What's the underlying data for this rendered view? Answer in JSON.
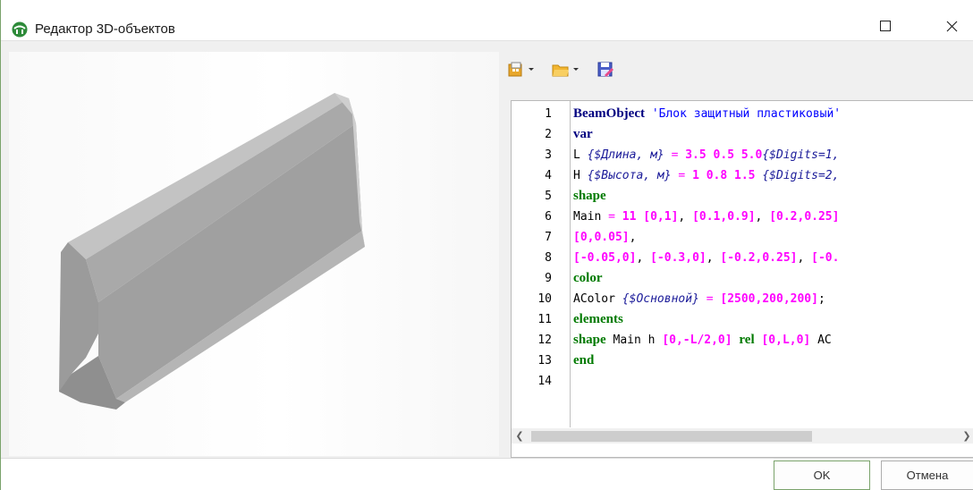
{
  "window": {
    "title": "Редактор 3D-объектов"
  },
  "toolbar": {
    "items": [
      "templates-dropdown",
      "open-dropdown",
      "save"
    ]
  },
  "editor": {
    "line_numbers": [
      "1",
      "2",
      "3",
      "4",
      "5",
      "6",
      "7",
      "8",
      "9",
      "10",
      "11",
      "12",
      "13",
      "14"
    ],
    "lines": [
      [
        {
          "c": "kwb",
          "t": "BeamObject"
        },
        {
          "c": "pl",
          "t": " "
        },
        {
          "c": "str",
          "t": "'Блок защитный пластиковый'"
        }
      ],
      [
        {
          "c": "kwb",
          "t": "var"
        }
      ],
      [
        {
          "c": "pl",
          "t": "L "
        },
        {
          "c": "cm",
          "t": "{$Длина, м}"
        },
        {
          "c": "pl",
          "t": " "
        },
        {
          "c": "op",
          "t": "="
        },
        {
          "c": "pl",
          "t": " "
        },
        {
          "c": "num",
          "t": "3.5 0.5 5.0"
        },
        {
          "c": "cm",
          "t": "{$Digits=1,"
        }
      ],
      [
        {
          "c": "pl",
          "t": "H "
        },
        {
          "c": "cm",
          "t": "{$Высота, м}"
        },
        {
          "c": "pl",
          "t": " "
        },
        {
          "c": "op",
          "t": "="
        },
        {
          "c": "pl",
          "t": " "
        },
        {
          "c": "num",
          "t": "1 0.8 1.5"
        },
        {
          "c": "pl",
          "t": " "
        },
        {
          "c": "cm",
          "t": "{$Digits=2,"
        }
      ],
      [
        {
          "c": "kw",
          "t": "shape"
        }
      ],
      [
        {
          "c": "pl",
          "t": "Main "
        },
        {
          "c": "op",
          "t": "="
        },
        {
          "c": "pl",
          "t": " "
        },
        {
          "c": "num",
          "t": "11 [0,1]"
        },
        {
          "c": "pl",
          "t": ", "
        },
        {
          "c": "num",
          "t": "[0.1,0.9]"
        },
        {
          "c": "pl",
          "t": ", "
        },
        {
          "c": "num",
          "t": "[0.2,0.25]"
        }
      ],
      [
        {
          "c": "num",
          "t": "[0,0.05]"
        },
        {
          "c": "pl",
          "t": ","
        }
      ],
      [
        {
          "c": "num",
          "t": "[-0.05,0]"
        },
        {
          "c": "pl",
          "t": ", "
        },
        {
          "c": "num",
          "t": "[-0.3,0]"
        },
        {
          "c": "pl",
          "t": ", "
        },
        {
          "c": "num",
          "t": "[-0.2,0.25]"
        },
        {
          "c": "pl",
          "t": ", "
        },
        {
          "c": "num",
          "t": "[-0."
        }
      ],
      [
        {
          "c": "kw",
          "t": "color"
        }
      ],
      [
        {
          "c": "pl",
          "t": "AColor "
        },
        {
          "c": "cm",
          "t": "{$Основной}"
        },
        {
          "c": "pl",
          "t": " "
        },
        {
          "c": "op",
          "t": "="
        },
        {
          "c": "pl",
          "t": " "
        },
        {
          "c": "num",
          "t": "[2500,200,200]"
        },
        {
          "c": "pl",
          "t": ";"
        }
      ],
      [
        {
          "c": "kw",
          "t": "elements"
        }
      ],
      [
        {
          "c": "kw",
          "t": "shape"
        },
        {
          "c": "pl",
          "t": " Main h "
        },
        {
          "c": "num",
          "t": "[0,-L/2,0]"
        },
        {
          "c": "pl",
          "t": " "
        },
        {
          "c": "kw",
          "t": "rel"
        },
        {
          "c": "pl",
          "t": " "
        },
        {
          "c": "num",
          "t": "[0,L,0]"
        },
        {
          "c": "pl",
          "t": " AC"
        }
      ],
      [
        {
          "c": "kw",
          "t": "end"
        }
      ],
      []
    ]
  },
  "buttons": {
    "ok": "OK",
    "cancel": "Отмена"
  },
  "colors": {
    "accent": "#7aa36b",
    "keyword": "#007a00",
    "number": "#ff00ff",
    "string": "#0000ff"
  }
}
